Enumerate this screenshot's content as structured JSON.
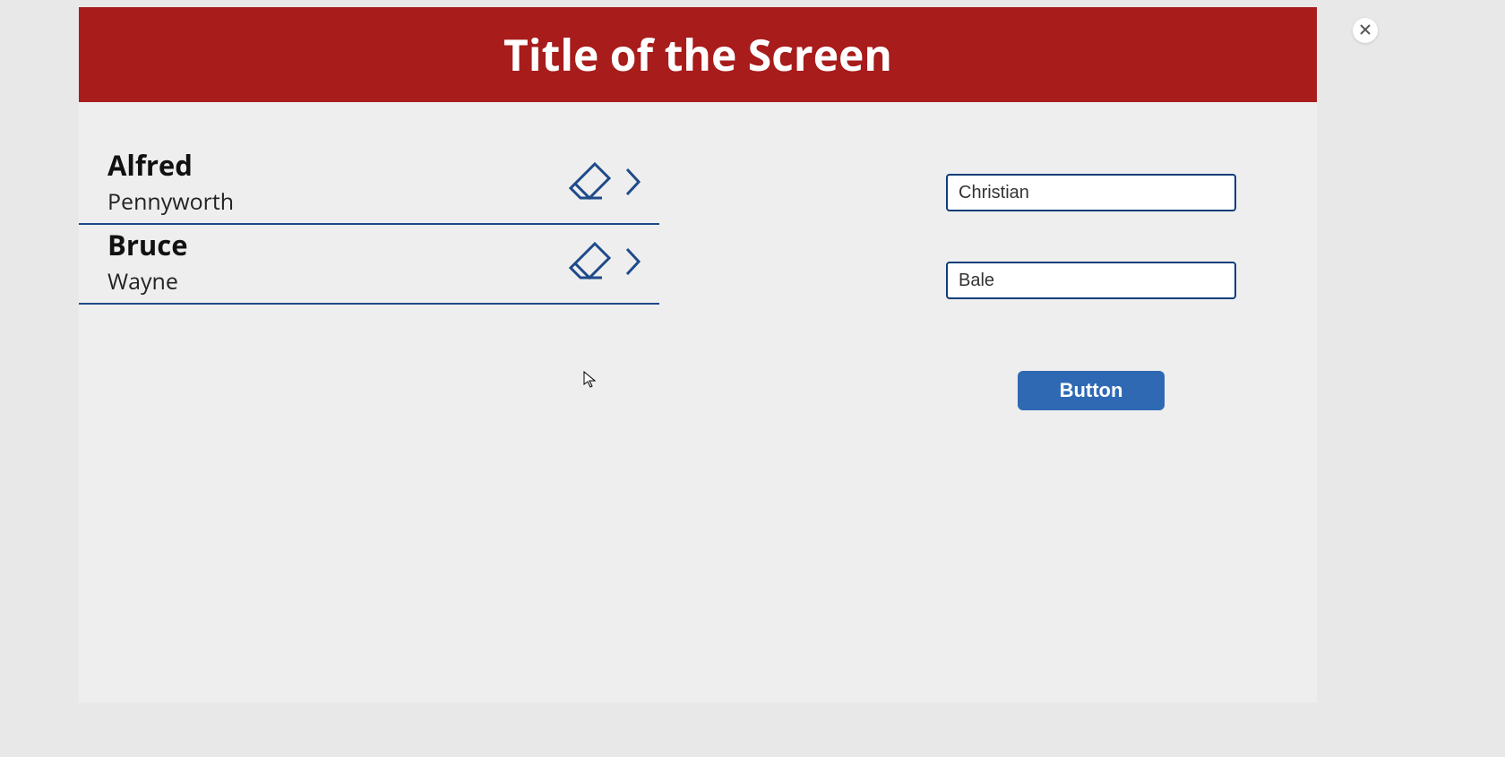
{
  "header": {
    "title": "Title of the Screen"
  },
  "list": {
    "items": [
      {
        "first_name": "Alfred",
        "last_name": "Pennyworth"
      },
      {
        "first_name": "Bruce",
        "last_name": "Wayne"
      }
    ]
  },
  "form": {
    "first_name_value": "Christian",
    "last_name_value": "Bale",
    "button_label": "Button"
  },
  "colors": {
    "header_bg": "#a81c1c",
    "accent_blue": "#1e4a8a",
    "button_blue": "#2f69b3"
  }
}
